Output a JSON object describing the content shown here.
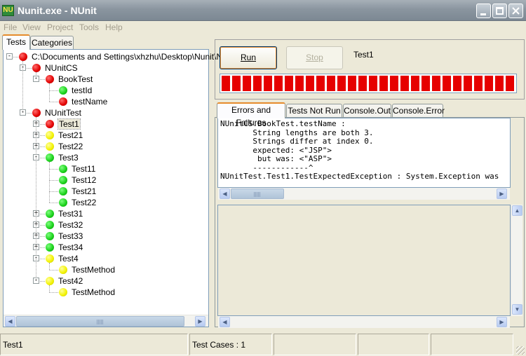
{
  "window": {
    "title": "Nunit.exe - NUnit",
    "icon_text": "NU",
    "icon_color": "#2e8b3a"
  },
  "menu": {
    "items": [
      "File",
      "View",
      "Project",
      "Tools",
      "Help"
    ]
  },
  "left_tabs": [
    "Tests",
    "Categories"
  ],
  "tree": {
    "rows": [
      {
        "label": "C:\\Documents and Settings\\xhzhu\\Desktop\\Nunit\\N",
        "status": "red",
        "level": 0,
        "expander": "-"
      },
      {
        "label": "NUnitCS",
        "status": "red",
        "level": 1,
        "expander": "-"
      },
      {
        "label": "BookTest",
        "status": "red",
        "level": 2,
        "expander": "-"
      },
      {
        "label": "testId",
        "status": "green",
        "level": 3,
        "expander": ""
      },
      {
        "label": "testName",
        "status": "red",
        "level": 3,
        "expander": ""
      },
      {
        "label": "NUnitTest",
        "status": "red",
        "level": 1,
        "expander": "-"
      },
      {
        "label": "Test1",
        "status": "red",
        "level": 2,
        "expander": "+",
        "selected": true
      },
      {
        "label": "Test21",
        "status": "yellow",
        "level": 2,
        "expander": "+"
      },
      {
        "label": "Test22",
        "status": "yellow",
        "level": 2,
        "expander": "+"
      },
      {
        "label": "Test3",
        "status": "green",
        "level": 2,
        "expander": "-"
      },
      {
        "label": "Test11",
        "status": "green",
        "level": 3,
        "expander": ""
      },
      {
        "label": "Test12",
        "status": "green",
        "level": 3,
        "expander": ""
      },
      {
        "label": "Test21",
        "status": "green",
        "level": 3,
        "expander": ""
      },
      {
        "label": "Test22",
        "status": "green",
        "level": 3,
        "expander": ""
      },
      {
        "label": "Test31",
        "status": "green",
        "level": 2,
        "expander": "+"
      },
      {
        "label": "Test32",
        "status": "green",
        "level": 2,
        "expander": "+"
      },
      {
        "label": "Test33",
        "status": "green",
        "level": 2,
        "expander": "+"
      },
      {
        "label": "Test34",
        "status": "green",
        "level": 2,
        "expander": "+"
      },
      {
        "label": "Test4",
        "status": "yellow",
        "level": 2,
        "expander": "-"
      },
      {
        "label": "TestMethod",
        "status": "yellow",
        "level": 3,
        "expander": ""
      },
      {
        "label": "Test42",
        "status": "yellow",
        "level": 2,
        "expander": "-"
      },
      {
        "label": "TestMethod",
        "status": "yellow",
        "level": 3,
        "expander": ""
      }
    ]
  },
  "controls": {
    "run_label": "Run",
    "stop_label": "Stop",
    "current_test": "Test1"
  },
  "progress": {
    "fraction": 1.0,
    "color": "#e60000",
    "segments": 28
  },
  "result_tabs": [
    "Errors and Failures",
    "Tests Not Run",
    "Console.Out",
    "Console.Error"
  ],
  "errors": {
    "text": "NUnitCS.BookTest.testName :\n       String lengths are both 3.\n       Strings differ at index 0.\n       expected: <\"JSP\">\n        but was: <\"ASP\">\n       ------------^\nNUnitTest.Test1.TestExpectedException : System.Exception was"
  },
  "status": {
    "left": "Test1",
    "test_cases": "Test Cases : 1"
  },
  "scroll_arrows": {
    "left": "◀",
    "right": "▶",
    "up": "▲",
    "down": "▼"
  }
}
